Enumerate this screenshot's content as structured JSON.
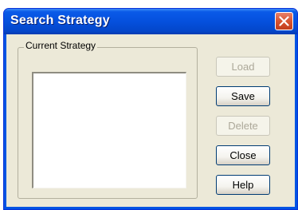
{
  "window": {
    "title": "Search Strategy"
  },
  "group": {
    "label": "Current Strategy",
    "items": []
  },
  "buttons": {
    "load": "Load",
    "save": "Save",
    "delete": "Delete",
    "close": "Close",
    "help": "Help"
  },
  "icons": {
    "close": "close-icon"
  },
  "colors": {
    "titlebar": "#0550dd",
    "close_button": "#d8532f",
    "dialog_background": "#ece9d8",
    "disabled_text": "#aca899"
  }
}
